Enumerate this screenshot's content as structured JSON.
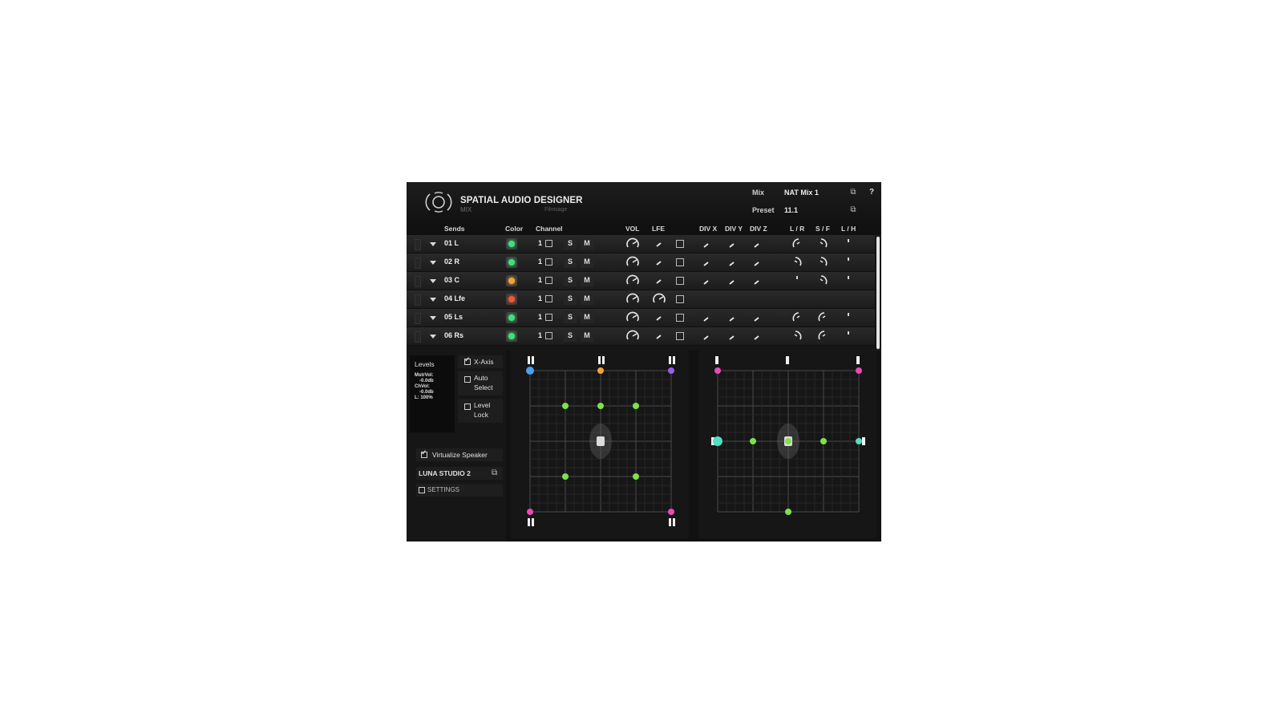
{
  "header": {
    "app_title": "SPATIAL AUDIO DESIGNER",
    "app_subtitle": "MIX",
    "brand": "Filmsage",
    "mix_label": "Mix",
    "mix_value": "NAT Mix 1",
    "preset_label": "Preset",
    "preset_value": "11.1",
    "help_label": "?",
    "icons": [
      "logo-icon",
      "copy-icon",
      "help-icon"
    ]
  },
  "columns": {
    "sends": "Sends",
    "color": "Color",
    "channel": "Channel",
    "vol": "VOL",
    "lfe": "LFE",
    "div_x": "DIV X",
    "div_y": "DIV Y",
    "div_z": "DIV Z",
    "lr": "L / R",
    "sf": "S / F",
    "lh": "L / H"
  },
  "rows": [
    {
      "name": "01 L",
      "color": "#3fe07a",
      "channel": "1",
      "solo": "S",
      "mute": "M"
    },
    {
      "name": "02 R",
      "color": "#3fe07a",
      "channel": "1",
      "solo": "S",
      "mute": "M"
    },
    {
      "name": "03 C",
      "color": "#f2a43a",
      "channel": "1",
      "solo": "S",
      "mute": "M"
    },
    {
      "name": "04 Lfe",
      "color": "#f0583a",
      "channel": "1",
      "solo": "S",
      "mute": "M"
    },
    {
      "name": "05 Ls",
      "color": "#3fe07a",
      "channel": "1",
      "solo": "S",
      "mute": "M"
    },
    {
      "name": "06 Rs",
      "color": "#3fe07a",
      "channel": "1",
      "solo": "S",
      "mute": "M"
    }
  ],
  "levels": {
    "title": "Levels",
    "lines": [
      "MstrVol:",
      "-0.0db",
      "ChVol:",
      "-0.0db",
      "L: 100%"
    ]
  },
  "options": {
    "x_axis": {
      "label": "X-Axis",
      "checked": true
    },
    "auto_select": {
      "line1": "Auto",
      "line2": "Select",
      "checked": false
    },
    "level_lock": {
      "line1": "Level",
      "line2": "Lock",
      "checked": false
    },
    "virtualize": {
      "label": "Virtualize Speaker",
      "checked": true
    },
    "room": {
      "label": "LUNA STUDIO 2"
    },
    "settings": {
      "label": "SETTINGS",
      "checked": false
    }
  },
  "colors": {
    "accent_green": "#7ee24a",
    "speaker_pink": "#e94bb6",
    "speaker_orange": "#f2a43a",
    "speaker_violet": "#9a5cf0",
    "speaker_cyan": "#4ee0c0",
    "panel_bg": "#161616"
  }
}
